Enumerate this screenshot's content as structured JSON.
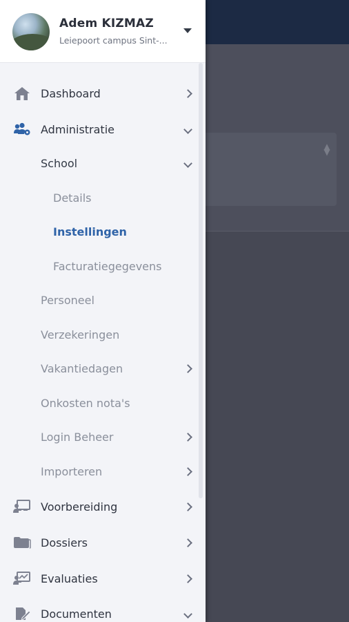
{
  "profile": {
    "name": "Adem KIZMAZ",
    "subtitle": "Leiepoort campus Sint-..."
  },
  "menu": {
    "dashboard": "Dashboard",
    "administratie": "Administratie",
    "school": "School",
    "details": "Details",
    "instellingen": "Instellingen",
    "facturatiegegevens": "Facturatiegegevens",
    "personeel": "Personeel",
    "verzekeringen": "Verzekeringen",
    "vakantiedagen": "Vakantiedagen",
    "onkosten": "Onkosten nota's",
    "login_beheer": "Login Beheer",
    "importeren": "Importeren",
    "voorbereiding": "Voorbereiding",
    "dossiers": "Dossiers",
    "evaluaties": "Evaluaties",
    "documenten": "Documenten"
  },
  "colors": {
    "accent": "#2f63a8",
    "drawer_bg": "#f3f4f8",
    "topbar": "#1c2a44"
  },
  "icons": {
    "dashboard": "home-icon",
    "administratie": "users-cog-icon",
    "voorbereiding": "teacher-board-icon",
    "dossiers": "folder-icon",
    "evaluaties": "chart-board-icon",
    "documenten": "edit-document-icon"
  }
}
